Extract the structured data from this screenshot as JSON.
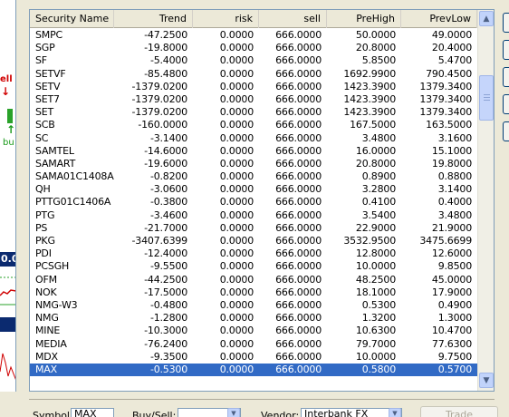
{
  "left_strip": {
    "sell_label": "ell",
    "buy_label": "bu",
    "box_label": "0.0"
  },
  "table": {
    "columns": [
      "Security Name",
      "Trend",
      "risk",
      "sell",
      "PreHigh",
      "PrevLow"
    ],
    "rows": [
      [
        "SMPC",
        "-47.2500",
        "0.0000",
        "666.0000",
        "50.0000",
        "49.0000"
      ],
      [
        "SGP",
        "-19.8000",
        "0.0000",
        "666.0000",
        "20.8000",
        "20.4000"
      ],
      [
        "SF",
        "-5.4000",
        "0.0000",
        "666.0000",
        "5.8500",
        "5.4700"
      ],
      [
        "SETVF",
        "-85.4800",
        "0.0000",
        "666.0000",
        "1692.9900",
        "790.4500"
      ],
      [
        "SETV",
        "-1379.0200",
        "0.0000",
        "666.0000",
        "1423.3900",
        "1379.3400"
      ],
      [
        "SET7",
        "-1379.0200",
        "0.0000",
        "666.0000",
        "1423.3900",
        "1379.3400"
      ],
      [
        "SET",
        "-1379.0200",
        "0.0000",
        "666.0000",
        "1423.3900",
        "1379.3400"
      ],
      [
        "SCB",
        "-160.0000",
        "0.0000",
        "666.0000",
        "167.5000",
        "163.5000"
      ],
      [
        "SC",
        "-3.1400",
        "0.0000",
        "666.0000",
        "3.4800",
        "3.1600"
      ],
      [
        "SAMTEL",
        "-14.6000",
        "0.0000",
        "666.0000",
        "16.0000",
        "15.1000"
      ],
      [
        "SAMART",
        "-19.6000",
        "0.0000",
        "666.0000",
        "20.8000",
        "19.8000"
      ],
      [
        "SAMA01C1408A",
        "-0.8200",
        "0.0000",
        "666.0000",
        "0.8900",
        "0.8800"
      ],
      [
        "QH",
        "-3.0600",
        "0.0000",
        "666.0000",
        "3.2800",
        "3.1400"
      ],
      [
        "PTTG01C1406A",
        "-0.3800",
        "0.0000",
        "666.0000",
        "0.4100",
        "0.4000"
      ],
      [
        "PTG",
        "-3.4600",
        "0.0000",
        "666.0000",
        "3.5400",
        "3.4800"
      ],
      [
        "PS",
        "-21.7000",
        "0.0000",
        "666.0000",
        "22.9000",
        "21.9000"
      ],
      [
        "PKG",
        "-3407.6399",
        "0.0000",
        "666.0000",
        "3532.9500",
        "3475.6699"
      ],
      [
        "PDI",
        "-12.4000",
        "0.0000",
        "666.0000",
        "12.8000",
        "12.6000"
      ],
      [
        "PCSGH",
        "-9.5500",
        "0.0000",
        "666.0000",
        "10.0000",
        "9.8500"
      ],
      [
        "OFM",
        "-44.2500",
        "0.0000",
        "666.0000",
        "48.2500",
        "45.0000"
      ],
      [
        "NOK",
        "-17.5000",
        "0.0000",
        "666.0000",
        "18.1000",
        "17.9000"
      ],
      [
        "NMG-W3",
        "-0.4800",
        "0.0000",
        "666.0000",
        "0.5300",
        "0.4900"
      ],
      [
        "NMG",
        "-1.2800",
        "0.0000",
        "666.0000",
        "1.3200",
        "1.3000"
      ],
      [
        "MINE",
        "-10.3000",
        "0.0000",
        "666.0000",
        "10.6300",
        "10.4700"
      ],
      [
        "MEDIA",
        "-76.2400",
        "0.0000",
        "666.0000",
        "79.7000",
        "77.6300"
      ],
      [
        "MDX",
        "-9.3500",
        "0.0000",
        "666.0000",
        "10.0000",
        "9.7500"
      ],
      [
        "MAX",
        "-0.5300",
        "0.0000",
        "666.0000",
        "0.5800",
        "0.5700"
      ]
    ],
    "selected_index": 26
  },
  "bottom": {
    "symbol_label": "Symbol:",
    "symbol_value": "MAX",
    "buysell_label": "Buy/Sell:",
    "buysell_value": "",
    "vendor_label": "Vendor:",
    "vendor_value": "Interbank FX",
    "trade_label": "Trade"
  },
  "colors": {
    "selection": "#316ac5",
    "window_bg": "#ece9d8",
    "border": "#7f9db9"
  }
}
